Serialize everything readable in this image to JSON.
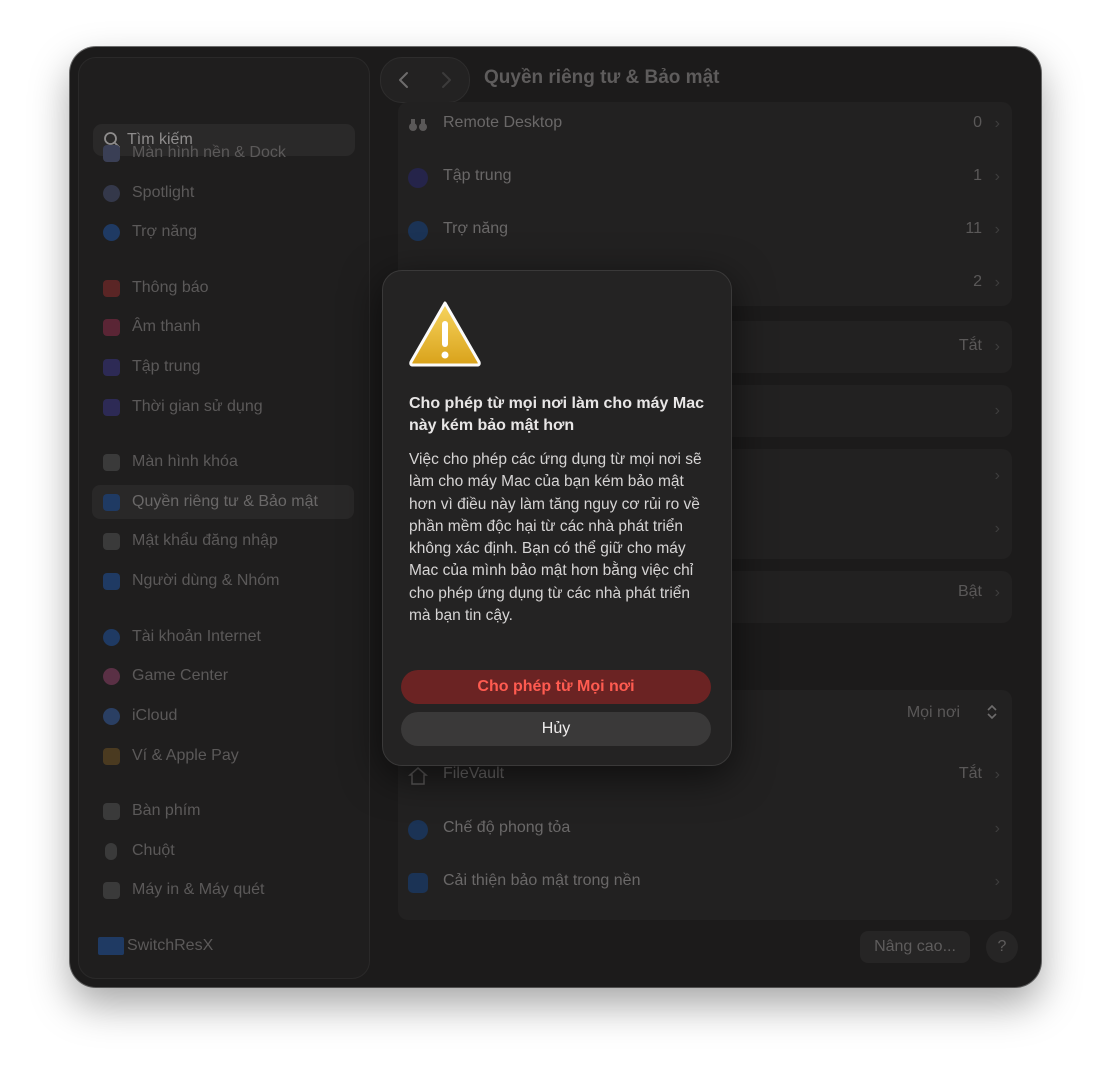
{
  "window": {
    "title": "Quyền riêng tư & Bảo mật"
  },
  "sidebar": {
    "search_placeholder": "Tìm kiếm",
    "items": [
      {
        "label": "Màn hình nền & Dock",
        "color": "#3a3f55"
      },
      {
        "label": "Spotlight",
        "color": "#34384a"
      },
      {
        "label": "Trợ năng",
        "color": "#1f3a63"
      },
      {
        "label": "Thông báo",
        "color": "#5a2525"
      },
      {
        "label": "Âm thanh",
        "color": "#5a2535"
      },
      {
        "label": "Tập trung",
        "color": "#2d2a55"
      },
      {
        "label": "Thời gian sử dụng",
        "color": "#2d2a55"
      },
      {
        "label": "Màn hình khóa",
        "color": "#3a3a3a"
      },
      {
        "label": "Quyền riêng tư & Bảo mật",
        "color": "#1f3a63"
      },
      {
        "label": "Mật khẩu đăng nhập",
        "color": "#3a3a3a"
      },
      {
        "label": "Người dùng & Nhóm",
        "color": "#1f3a63"
      },
      {
        "label": "Tài khoản Internet",
        "color": "#1f3a63"
      },
      {
        "label": "Game Center",
        "color": "#5a3045"
      },
      {
        "label": "iCloud",
        "color": "#2a3f63"
      },
      {
        "label": "Ví & Apple Pay",
        "color": "#4a3a20"
      },
      {
        "label": "Bàn phím",
        "color": "#3a3a3a"
      },
      {
        "label": "Chuột",
        "color": "#3a3a3a"
      },
      {
        "label": "Máy in & Máy quét",
        "color": "#3a3a3a"
      },
      {
        "label": "SwitchResX",
        "color": "#1f3a63"
      }
    ]
  },
  "content": {
    "rows": [
      {
        "label": "Remote Desktop",
        "value": "0"
      },
      {
        "label": "Tập trung",
        "value": "1"
      },
      {
        "label": "Trợ năng",
        "value": "11"
      },
      {
        "label": "",
        "value": "2"
      },
      {
        "label": "",
        "value": "Tắt"
      },
      {
        "label": "",
        "value": ""
      },
      {
        "label": "",
        "value": ""
      },
      {
        "label": "",
        "value": ""
      },
      {
        "label": "",
        "value": "Bật"
      }
    ],
    "allow_from_value": "Mọi nơi",
    "security_rows": [
      {
        "label": "FileVault",
        "value": "Tắt"
      },
      {
        "label": "Chế độ phong tỏa",
        "value": ""
      },
      {
        "label": "Cải thiện bảo mật trong nền",
        "value": ""
      }
    ],
    "advanced_button": "Nâng cao...",
    "help_button": "?"
  },
  "dialog": {
    "icon": "warning-icon",
    "title": "Cho phép từ mọi nơi làm cho máy Mac này kém bảo mật hơn",
    "body": "Việc cho phép các ứng dụng từ mọi nơi sẽ làm cho máy Mac của bạn kém bảo mật hơn vì điều này làm tăng nguy cơ rủi ro về phần mềm độc hại từ các nhà phát triển không xác định. Bạn có thể giữ cho máy Mac của mình bảo mật hơn bằng việc chỉ cho phép ứng dụng từ các nhà phát triển mà bạn tin cậy.",
    "confirm_button": "Cho phép từ Mọi nơi",
    "cancel_button": "Hủy"
  },
  "colors": {
    "accent_danger": "#ff5b50",
    "window_bg": "#1c1b1b",
    "traffic_yellow": "#f7c021",
    "traffic_green": "#31c840"
  }
}
